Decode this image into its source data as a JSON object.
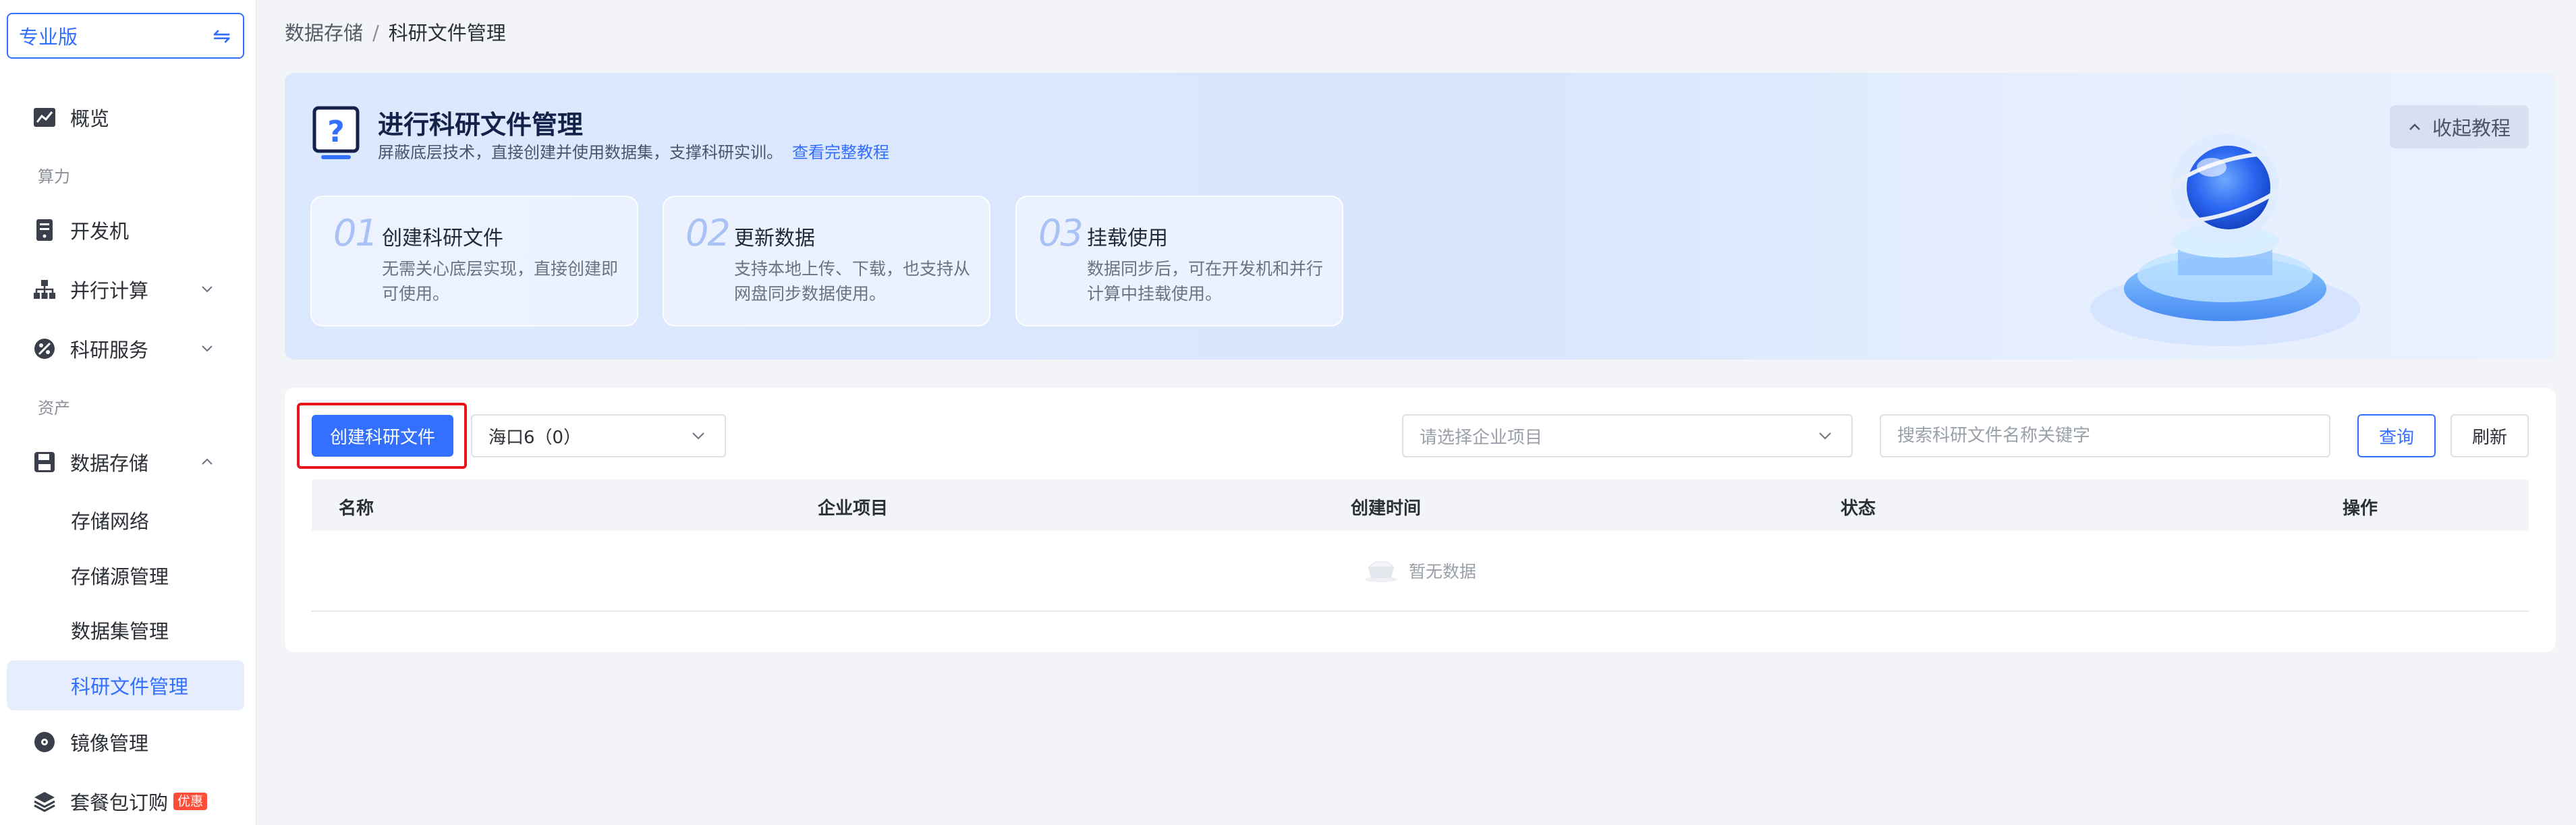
{
  "sidebar": {
    "edition_label": "专业版",
    "items": [
      {
        "label": "概览"
      },
      {
        "label": "开发机"
      },
      {
        "label": "并行计算"
      },
      {
        "label": "科研服务"
      },
      {
        "label": "数据存储"
      },
      {
        "label": "镜像管理"
      },
      {
        "label": "套餐包订购"
      }
    ],
    "groups": {
      "compute": "算力",
      "assets": "资产"
    },
    "sub_items": [
      {
        "label": "存储网络"
      },
      {
        "label": "存储源管理"
      },
      {
        "label": "数据集管理"
      },
      {
        "label": "科研文件管理",
        "active": true
      }
    ],
    "promo_badge": "优惠"
  },
  "breadcrumb": {
    "parent": "数据存储",
    "separator": "/",
    "current": "科研文件管理"
  },
  "banner": {
    "title": "进行科研文件管理",
    "description": "屏蔽底层技术，直接创建并使用数据集，支撑科研实训。",
    "link": "查看完整教程",
    "collapse_label": "收起教程",
    "steps": [
      {
        "num": "01",
        "title": "创建科研文件",
        "desc": "无需关心底层实现，直接创建即可使用。"
      },
      {
        "num": "02",
        "title": "更新数据",
        "desc": "支持本地上传、下载，也支持从网盘同步数据使用。"
      },
      {
        "num": "03",
        "title": "挂载使用",
        "desc": "数据同步后，可在开发机和并行计算中挂载使用。"
      }
    ]
  },
  "toolbar": {
    "create_label": "创建科研文件",
    "region_value": "海口6（0）",
    "project_placeholder": "请选择企业项目",
    "search_placeholder": "搜索科研文件名称关键字",
    "query_label": "查询",
    "refresh_label": "刷新"
  },
  "table": {
    "columns": [
      "名称",
      "企业项目",
      "创建时间",
      "状态",
      "操作"
    ],
    "empty_text": "暂无数据"
  },
  "colors": {
    "accent": "#3370ff",
    "highlight_border": "#e8141c",
    "badge": "#ff4d3a"
  }
}
